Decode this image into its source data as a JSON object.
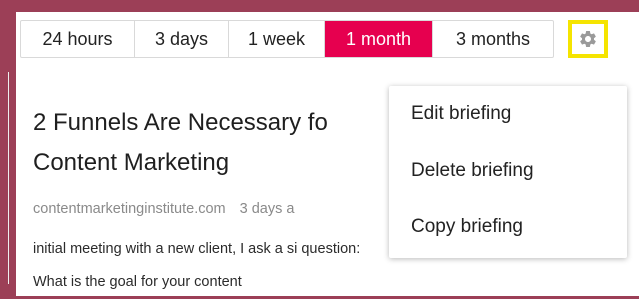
{
  "time_tabs": [
    {
      "label": "24 hours",
      "active": false
    },
    {
      "label": "3 days",
      "active": false
    },
    {
      "label": "1 week",
      "active": false
    },
    {
      "label": "1 month",
      "active": true
    },
    {
      "label": "3 months",
      "active": false
    }
  ],
  "settings": {
    "icon": "gear-icon"
  },
  "article": {
    "title": "2 Funnels Are Necessary fo Content Marketing",
    "source": "contentmarketinginstitute.com",
    "age": "3 days a",
    "excerpt": "initial meeting with a new client, I ask a si question: What is the goal for your content"
  },
  "menu": {
    "items": [
      "Edit briefing",
      "Delete briefing",
      "Copy briefing"
    ]
  },
  "colors": {
    "background": "#9c3f57",
    "active_tab": "#e6004f",
    "highlight": "#f5e400"
  }
}
